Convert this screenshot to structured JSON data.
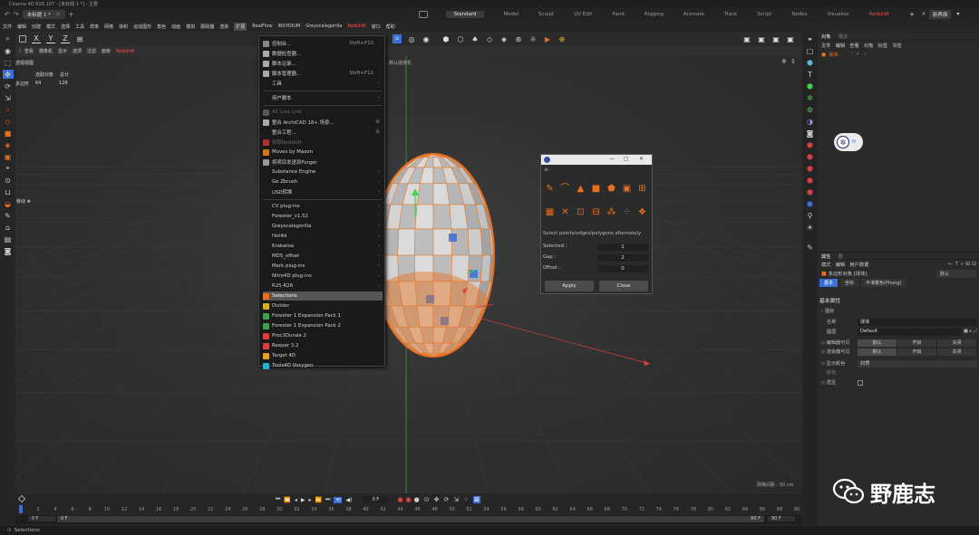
{
  "app_title": "Cinema 4D R26.107 - [未标题 1 *] - 主要",
  "doc_tab": "未标题 1 *",
  "layouts": [
    "Standard",
    "Model",
    "Sculpt",
    "UV Edit",
    "Paint",
    "Rigging",
    "Animate",
    "Track",
    "Script",
    "Nodes",
    "Visualize",
    "Redshift"
  ],
  "layout_active": "Standard",
  "layout_right": "新界面",
  "menu": [
    "文件",
    "编辑",
    "创建",
    "模式",
    "选择",
    "工具",
    "样条",
    "网格",
    "体积",
    "运动图形",
    "角色",
    "动画",
    "模拟",
    "跟踪器",
    "渲染",
    "扩展",
    "RealFlow",
    "INSYDIUM",
    "Greyscalegorilla",
    "Redshift",
    "窗口",
    "帮助"
  ],
  "menu_active": "扩展",
  "toolbar": {
    "x": "X",
    "y": "Y",
    "z": "Z"
  },
  "viewport_menu": [
    "查看",
    "摄像机",
    "显示",
    "选项",
    "过滤",
    "面板",
    "Redshift"
  ],
  "viewport": {
    "name": "透视视图",
    "camera": "默认摄像机",
    "camera_icon": ":·:",
    "stats_label": "选取对象",
    "stats_total": "总计",
    "poly_label": "多边形",
    "poly_selected": "64",
    "poly_total": "128",
    "move_label": "移动",
    "grid_spacing": "网格间距 : 50 cm"
  },
  "dropdown": {
    "items": [
      {
        "label": "控制台...",
        "shortcut": "Shift+F10",
        "icon": true
      },
      {
        "label": "数据检查器...",
        "icon": true
      },
      {
        "label": "脚本记录...",
        "icon": true
      },
      {
        "label": "脚本管理器...",
        "shortcut": "Shift+F11",
        "icon": true
      },
      {
        "label": "工具",
        "submenu": true
      },
      {
        "sep": true
      },
      {
        "label": "用户脚本",
        "submenu": true
      },
      {
        "sep": true
      },
      {
        "label": "AC Live Link",
        "disabled": true,
        "icon": true
      },
      {
        "label": "整合 ArchiCAD 18+ 场景...",
        "icon": true,
        "gear": true
      },
      {
        "label": "整合工程...",
        "gear": true
      },
      {
        "label": "获取Redshift",
        "disabled": true,
        "icon": true
      },
      {
        "label": "Moves by Maxon",
        "icon": true
      },
      {
        "label": "将项目发送到Forger",
        "icon": true
      },
      {
        "label": "Substance Engine",
        "submenu": true
      },
      {
        "label": "Go Zbrush",
        "submenu": true
      },
      {
        "label": "USD转换",
        "submenu": true
      },
      {
        "sep": true
      },
      {
        "label": "CV plug-ins",
        "submenu": true
      },
      {
        "label": "Forester_v1.52",
        "submenu": true
      },
      {
        "label": "Greyscalegorilla",
        "submenu": true
      },
      {
        "label": "Hot4d",
        "submenu": true
      },
      {
        "label": "Krakatoa",
        "submenu": true
      },
      {
        "label": "MDS_offset",
        "submenu": true
      },
      {
        "label": "Merk plug-ins",
        "submenu": true
      },
      {
        "label": "Nitro4D plug-ins",
        "submenu": true
      },
      {
        "label": "R25-R26",
        "submenu": true
      },
      {
        "label": "Selections",
        "icon": true,
        "highlight": true
      },
      {
        "label": "Divider",
        "icon": true
      },
      {
        "label": "Forester 1 Expansion Pack 1",
        "icon": true
      },
      {
        "label": "Forester 1 Expansion Pack 2",
        "icon": true
      },
      {
        "label": "Proc3Durale 2",
        "icon": true
      },
      {
        "label": "Reeper 3.2",
        "icon": true
      },
      {
        "label": "Target 4D",
        "icon": true
      },
      {
        "label": "Tools4D Voxygen",
        "icon": true
      }
    ]
  },
  "dialog": {
    "title_controls": [
      "—",
      "□",
      "✕"
    ],
    "menu_icon": "≡",
    "hint": "Select points/edges/polygons alternately",
    "fields": [
      {
        "label": "Selected :",
        "value": "1"
      },
      {
        "label": "Gap :",
        "value": "2"
      },
      {
        "label": "Offset :",
        "value": "0"
      }
    ],
    "apply": "Apply",
    "close": "Close"
  },
  "objects_panel": {
    "tabs": [
      "对象",
      "场次"
    ],
    "menu": [
      "文件",
      "编辑",
      "查看",
      "对象",
      "标签",
      "书签"
    ],
    "item": "球体",
    "badge": "H"
  },
  "attributes_panel": {
    "tabs": [
      "属性",
      "层"
    ],
    "menu": [
      "模式",
      "编辑",
      "用户数据"
    ],
    "object_line": "多边形对象 [球体]",
    "preset": "默认",
    "subtabs": [
      "基本",
      "坐标",
      "平滑着色(Phong)"
    ],
    "section": "基本属性",
    "icon_label": "图标",
    "name_label": "名称",
    "name_value": "球体",
    "layer_label": "图层",
    "layer_value": "Default",
    "editor_label": "编辑器可见",
    "render_label": "渲染器可见",
    "seg_options": [
      "默认",
      "开启",
      "关闭"
    ],
    "color_label": "显示颜色",
    "color_value": "材质",
    "color_sub": "颜色",
    "xray_label": "透显"
  },
  "timeline": {
    "ticks": [
      "0",
      "2",
      "4",
      "6",
      "8",
      "10",
      "12",
      "14",
      "16",
      "18",
      "20",
      "22",
      "24",
      "26",
      "28",
      "30",
      "32",
      "34",
      "36",
      "38",
      "40",
      "42",
      "44",
      "46",
      "48",
      "50",
      "52",
      "54",
      "56",
      "58",
      "60",
      "62",
      "64",
      "66",
      "68",
      "70",
      "72",
      "74",
      "76",
      "78",
      "80",
      "82",
      "84",
      "86",
      "88",
      "90"
    ],
    "current_frame": "0 F",
    "start": "0 F",
    "start2": "0 F",
    "end": "90 F",
    "end2": "90 F"
  },
  "status_text": "Selections",
  "watermark": "野鹿志",
  "colors": {
    "accent_orange": "#e8701e",
    "selection_blue": "#3a6fd8",
    "axis_green": "#3fd64f",
    "axis_red": "#d84040"
  }
}
